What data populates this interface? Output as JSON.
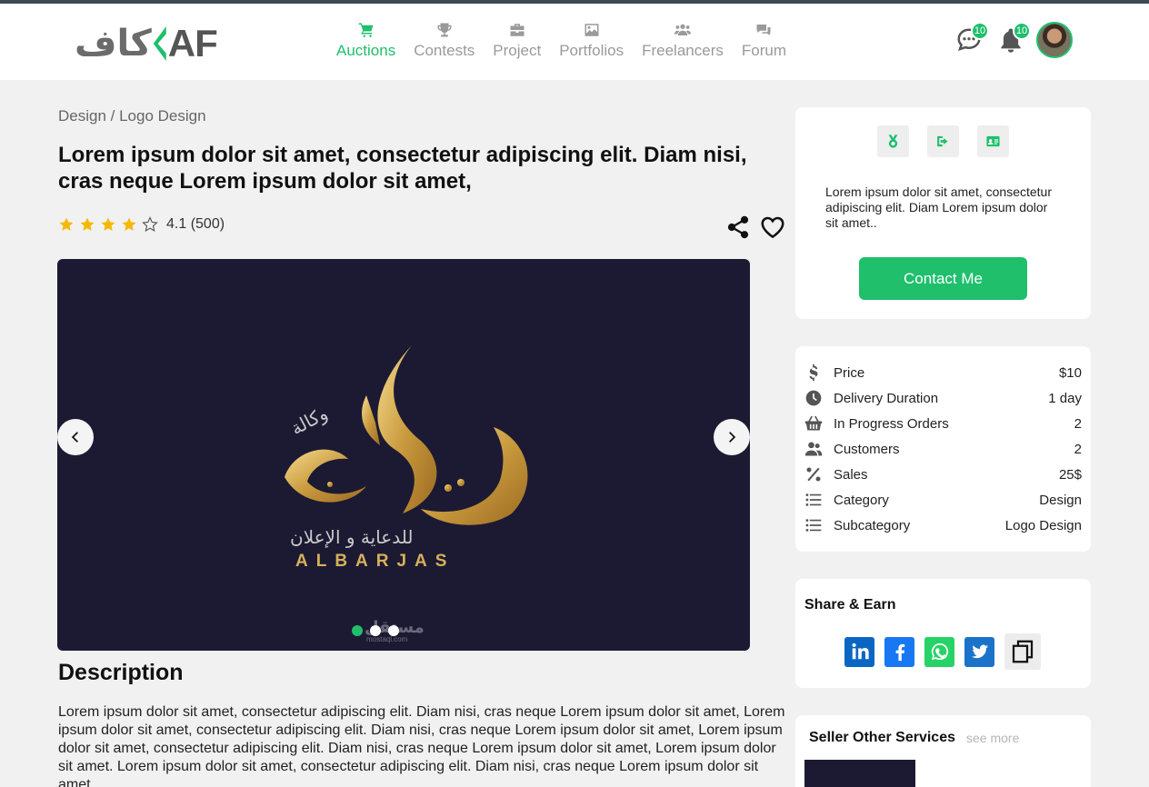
{
  "header": {
    "logo_arabic": "كاف",
    "logo_latin": "AF",
    "nav": [
      {
        "label": "Auctions",
        "icon": "cart-icon",
        "active": true
      },
      {
        "label": "Contests",
        "icon": "trophy-icon",
        "active": false
      },
      {
        "label": "Project",
        "icon": "briefcase-icon",
        "active": false
      },
      {
        "label": "Portfolios",
        "icon": "image-icon",
        "active": false
      },
      {
        "label": "Freelancers",
        "icon": "users-icon",
        "active": false
      },
      {
        "label": "Forum",
        "icon": "comments-icon",
        "active": false
      }
    ],
    "messages_count": "10",
    "notifications_count": "10"
  },
  "breadcrumb": "Design / Logo Design",
  "service": {
    "title": "Lorem ipsum dolor sit amet, consectetur adipiscing elit. Diam nisi, cras neque Lorem ipsum dolor sit amet,",
    "rating": 4.1,
    "rating_text": "4.1 (500)",
    "stars_filled": 4,
    "stars_total": 5
  },
  "carousel": {
    "slide_count": 3,
    "active_index": 0,
    "image_text": {
      "arabic_main": "البرجس",
      "arabic_small": "وكالة",
      "arabic_sub": "للدعاية و الإعلان",
      "latin": "ALBARJAS",
      "watermark": "مستقل",
      "watermark_url": "mostaql.com"
    }
  },
  "description": {
    "title": "Description",
    "body": "Lorem ipsum dolor sit amet, consectetur adipiscing elit. Diam nisi, cras neque Lorem ipsum dolor sit amet, Lorem ipsum dolor sit amet, consectetur adipiscing elit. Diam nisi, cras neque Lorem ipsum dolor sit amet, Lorem ipsum dolor sit amet, consectetur adipiscing elit. Diam nisi, cras neque Lorem ipsum dolor sit amet, Lorem ipsum dolor sit amet. Lorem ipsum dolor sit amet, consectetur adipiscing elit. Diam nisi, cras neque Lorem ipsum dolor sit amet,"
  },
  "profile_card": {
    "icons": [
      "medal-icon",
      "sign-out-icon",
      "id-card-icon"
    ],
    "text": "Lorem ipsum dolor sit amet, consectetur adipiscing elit. Diam Lorem ipsum dolor sit amet..",
    "contact_label": "Contact Me"
  },
  "stats": [
    {
      "icon": "dollar-icon",
      "label": "Price",
      "value": "$10"
    },
    {
      "icon": "clock-icon",
      "label": "Delivery Duration",
      "value": "1 day"
    },
    {
      "icon": "basket-icon",
      "label": "In Progress Orders",
      "value": "2"
    },
    {
      "icon": "users-icon",
      "label": "Customers",
      "value": "2"
    },
    {
      "icon": "percent-icon",
      "label": "Sales",
      "value": "25$"
    },
    {
      "icon": "list-icon",
      "label": "Category",
      "value": "Design"
    },
    {
      "icon": "list-icon",
      "label": "Subcategory",
      "value": "Logo Design"
    }
  ],
  "share_card": {
    "title": "Share & Earn",
    "icons": [
      "linkedin-icon",
      "facebook-icon",
      "whatsapp-icon",
      "twitter-icon",
      "copy-icon"
    ]
  },
  "other_services": {
    "title": "Seller Other Services",
    "see_more": "see more"
  },
  "colors": {
    "accent": "#1fbf6c",
    "dark_slide": "#1c1a33",
    "linkedin": "#0a66c2",
    "facebook": "#1877f2",
    "whatsapp": "#25d366",
    "twitter": "#1da1f2"
  }
}
